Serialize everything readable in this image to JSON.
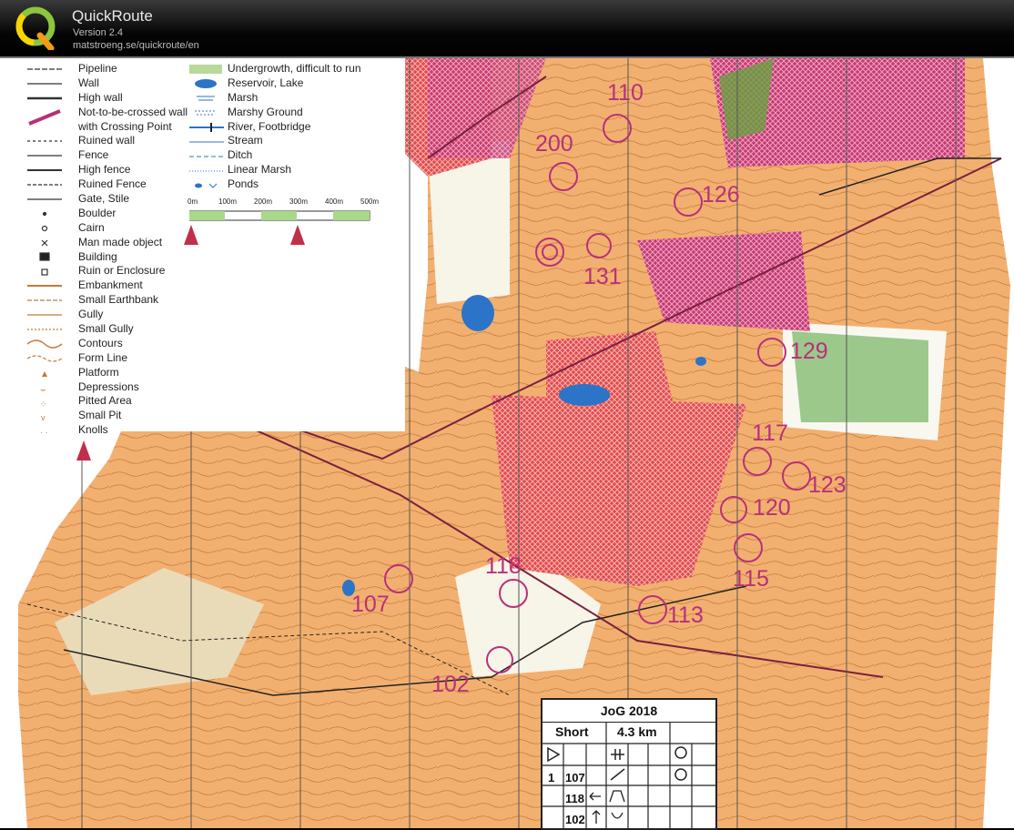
{
  "app": {
    "name": "QuickRoute",
    "version": "Version 2.4",
    "url": "matstroeng.se/quickroute/en"
  },
  "legend": {
    "left_items": [
      "Pipeline",
      "Wall",
      "High wall",
      "Not-to-be-crossed wall",
      "with Crossing Point",
      "Ruined wall",
      "Fence",
      "High fence",
      "Ruined Fence",
      "Gate, Stile",
      "Boulder",
      "Cairn",
      "Man made object",
      "Building",
      "Ruin or Enclosure",
      "Embankment",
      "Small Earthbank",
      "Gully",
      "Small Gully",
      "Contours",
      "Form Line",
      "Platform",
      "Depressions",
      "Pitted Area",
      "Small Pit",
      "Knolls"
    ],
    "right_items": [
      "Undergrowth, difficult to run",
      "Reservoir, Lake",
      "Marsh",
      "Marshy Ground",
      "River, Footbridge",
      "Stream",
      "Ditch",
      "Linear Marsh",
      "Ponds"
    ],
    "scale": [
      "0m",
      "100m",
      "200m",
      "300m",
      "400m",
      "500m"
    ]
  },
  "controls": [
    "110",
    "200",
    "126",
    "131",
    "129",
    "117",
    "123",
    "120",
    "115",
    "113",
    "118",
    "107",
    "102"
  ],
  "description_sheet": {
    "event": "JoG 2018",
    "class": "Short",
    "length": "4.3 km",
    "row_number": "1",
    "controls": [
      "107",
      "118",
      "102"
    ]
  },
  "colors": {
    "terrain": "#f2b070",
    "open": "#ffffff",
    "oob": "#c0306a",
    "course": "#b8307a",
    "water": "#2b74c8",
    "vegetation": "#5fa84a"
  }
}
